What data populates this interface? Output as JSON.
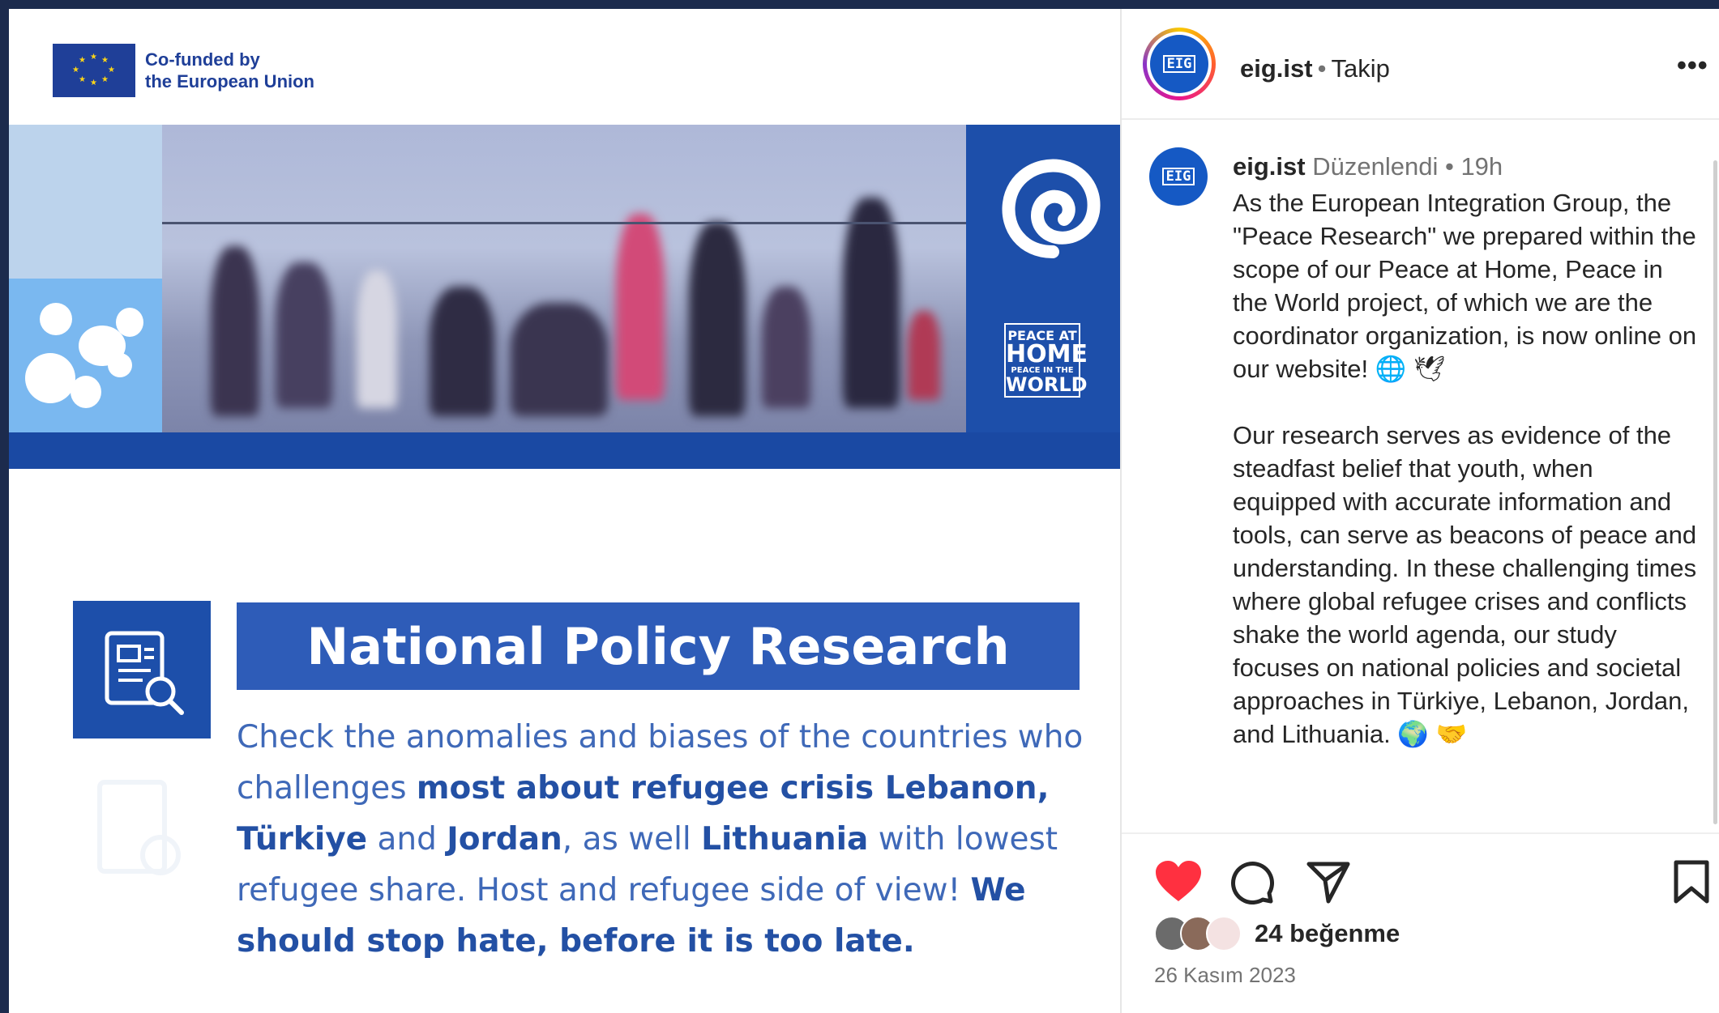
{
  "post_image": {
    "eu_logo_line1": "Co-funded by",
    "eu_logo_line2": "the European Union",
    "pahw_line1": "PEACE AT",
    "pahw_line2": "HOME",
    "pahw_line3": "PEACE IN THE",
    "pahw_line4": "WORLD",
    "title": "National Policy Research",
    "body_segments": [
      {
        "text": "Check the anomalies and biases of the countries who challenges ",
        "bold": false
      },
      {
        "text": "most about refugee crisis Lebanon, Türkiye",
        "bold": true
      },
      {
        "text": " and ",
        "bold": false
      },
      {
        "text": "Jordan",
        "bold": true
      },
      {
        "text": ", as well ",
        "bold": false
      },
      {
        "text": "Lithuania",
        "bold": true
      },
      {
        "text": " with lowest refugee share. Host and refugee side of view! ",
        "bold": false
      },
      {
        "text": "We should stop hate, before it is too late.",
        "bold": true
      }
    ]
  },
  "header": {
    "username": "eig.ist",
    "separator": "•",
    "follow_label": "Takip",
    "avatar_text": "EIG"
  },
  "caption": {
    "username": "eig.ist",
    "edited_label": "Düzenlendi",
    "separator": "•",
    "time": "19h",
    "paragraph1": "As the European Integration Group, the \"Peace Research\" we prepared within the scope of our Peace at Home, Peace in the World project, of which we are the coordinator organization, is now online on our website! 🌐 🕊",
    "paragraph2": "Our research serves as evidence of the steadfast belief that youth, when equipped with accurate information and tools, can serve as beacons of peace and understanding. In these challenging times where global refugee crises and conflicts shake the world agenda, our study focuses on national policies and societal approaches in Türkiye, Lebanon, Jordan, and Lithuania. 🌍 🤝"
  },
  "actions": {
    "like_icon": "heart-icon",
    "comment_icon": "comment-icon",
    "share_icon": "send-icon",
    "save_icon": "bookmark-icon"
  },
  "likes": {
    "text": "24 beğenme"
  },
  "date": "26 Kasım 2023",
  "colors": {
    "eu_blue": "#1f3f98",
    "brand_blue": "#1d4faa",
    "like_red": "#ff3040"
  }
}
